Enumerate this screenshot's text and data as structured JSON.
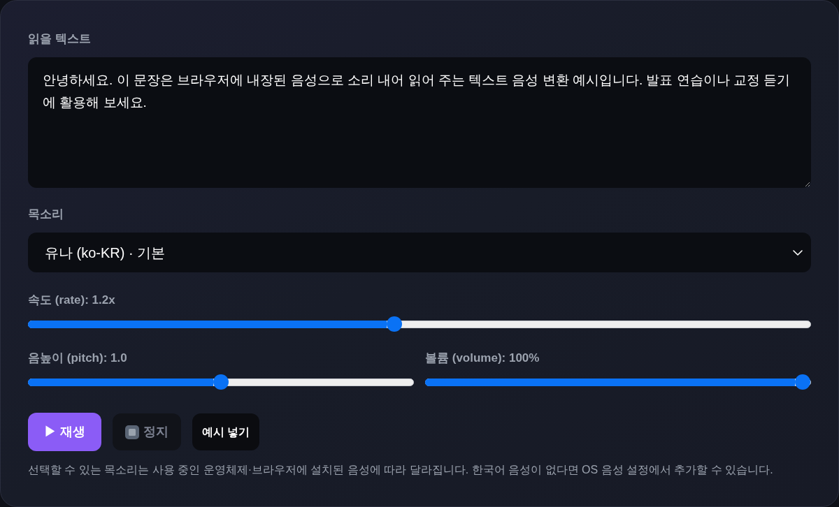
{
  "text_section": {
    "label": "읽을 텍스트",
    "value": "안녕하세요. 이 문장은 브라우저에 내장된 음성으로 소리 내어 읽어 주는 텍스트 음성 변환 예시입니다. 발표 연습이나 교정 듣기에 활용해 보세요."
  },
  "voice_section": {
    "label": "목소리",
    "value": "유나 (ko-KR) · 기본"
  },
  "sliders": [
    {
      "label": "속도 (rate): 1.2x",
      "level": 0.467
    },
    {
      "label": "음높이 (pitch): 1.0",
      "level": 0.5
    },
    {
      "label": "볼륨 (volume): 100%",
      "level": 1.0
    }
  ],
  "buttons": [
    {
      "label": "▶ 재생",
      "kind": "primary",
      "disabled": false
    },
    {
      "label": "정지",
      "kind": "stop",
      "disabled": true
    },
    {
      "label": "예시 넣기",
      "kind": "plain",
      "disabled": false
    }
  ],
  "note": "선택할 수 있는 목소리는 사용 중인 운영체제·브라우저에 설치된 음성에 따라 달라집니다. 한국어 음성이 없다면 OS 음성 설정에서 추가할 수 있습니다."
}
